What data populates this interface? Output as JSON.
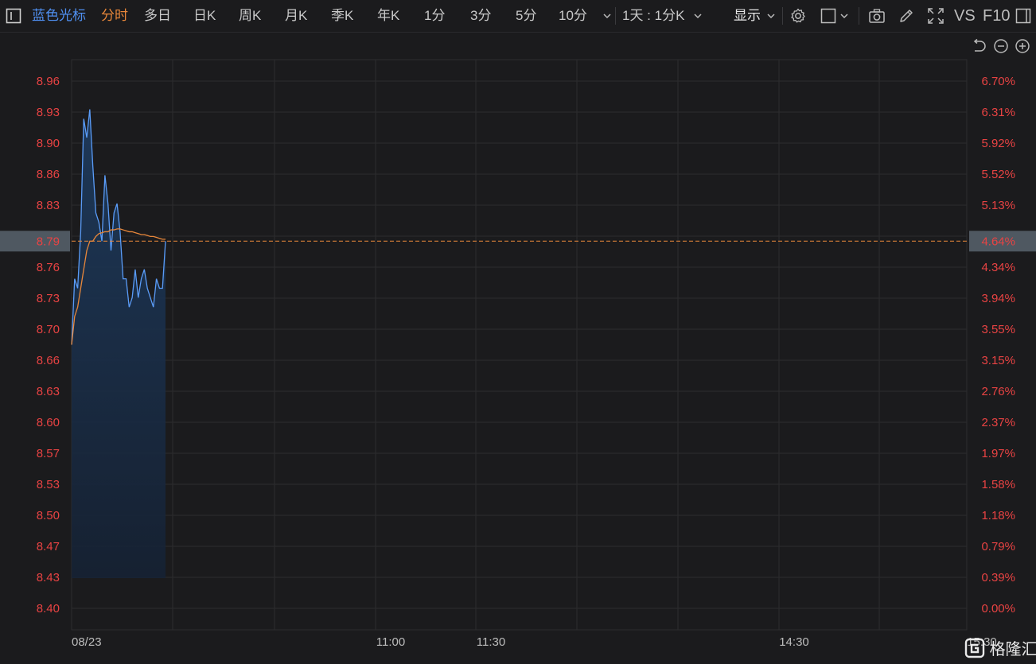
{
  "toolbar": {
    "stock_name": "蓝色光标",
    "tabs": [
      "分时",
      "多日",
      "日K",
      "周K",
      "月K",
      "季K",
      "年K",
      "1分",
      "3分",
      "5分",
      "10分"
    ],
    "active_tab": "分时",
    "period_selector": "1天 : 1分K",
    "display_label": "显示",
    "vs_label": "VS",
    "f10_label": "F10"
  },
  "watermark": "格隆汇",
  "colors": {
    "background": "#1b1b1d",
    "price_line": "#5a9cf8",
    "avg_line": "#e8873a",
    "axis_red": "#e94343",
    "active_tab": "#e8873a",
    "stock_name": "#4f8ff0",
    "grid": "#2c2c2f"
  },
  "chart_data": {
    "type": "line",
    "x_labels": [
      "08/23",
      "11:00",
      "11:30",
      "14:30",
      "15:30"
    ],
    "y_ticks": [
      8.96,
      8.93,
      8.9,
      8.86,
      8.83,
      8.8,
      8.76,
      8.73,
      8.7,
      8.66,
      8.63,
      8.6,
      8.57,
      8.53,
      8.5,
      8.47,
      8.43,
      8.4
    ],
    "y_tick_labels": [
      "8.96",
      "8.93",
      "8.90",
      "8.86",
      "8.83",
      "",
      "8.76",
      "8.73",
      "8.70",
      "8.66",
      "8.63",
      "8.60",
      "8.57",
      "8.53",
      "8.50",
      "8.47",
      "8.43",
      "8.40"
    ],
    "pct_tick_labels": [
      "6.70%",
      "6.31%",
      "5.92%",
      "5.52%",
      "5.13%",
      "4.73%",
      "4.34%",
      "3.94%",
      "3.55%",
      "3.15%",
      "2.76%",
      "2.37%",
      "1.97%",
      "1.58%",
      "1.18%",
      "0.79%",
      "0.39%",
      "0.00%"
    ],
    "ylim": [
      8.4,
      8.96
    ],
    "current_price": "8.79",
    "current_pct": "4.64%",
    "series": [
      {
        "values": [
          8.68,
          8.75,
          8.74,
          8.8,
          8.92,
          8.9,
          8.93,
          8.87,
          8.82,
          8.81,
          8.79,
          8.86,
          8.83,
          8.78,
          8.82,
          8.83,
          8.8,
          8.75,
          8.75,
          8.72,
          8.73,
          8.76,
          8.73,
          8.75,
          8.76,
          8.74,
          8.73,
          8.72,
          8.75,
          8.74,
          8.74,
          8.79
        ]
      },
      {
        "values": [
          8.68,
          8.71,
          8.72,
          8.74,
          8.76,
          8.78,
          8.79,
          8.79,
          8.795,
          8.798,
          8.799,
          8.8,
          8.8,
          8.802,
          8.802,
          8.803,
          8.803,
          8.802,
          8.801,
          8.8,
          8.8,
          8.799,
          8.798,
          8.797,
          8.797,
          8.796,
          8.795,
          8.795,
          8.794,
          8.793,
          8.792,
          8.792
        ]
      }
    ]
  }
}
